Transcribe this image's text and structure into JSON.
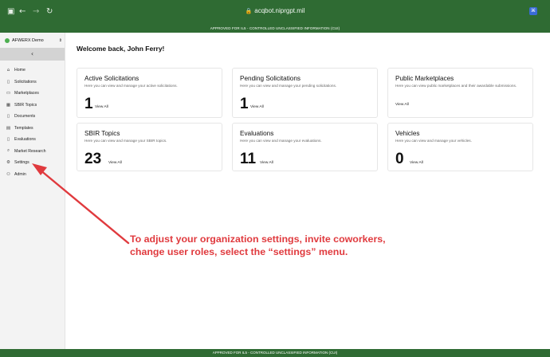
{
  "browser": {
    "url": "acqbot.niprgpt.mil"
  },
  "banner": {
    "top": "APPROVED FOR IL5 - CONTROLLED UNCLASSIFIED INFORMATION (CUI)",
    "bottom": "APPROVED FOR IL5 - CONTROLLED UNCLASSIFIED INFORMATION (CUI)"
  },
  "sidebar": {
    "org_name": "AFWERX Demo",
    "items": [
      {
        "label": "Home",
        "icon": "home-icon"
      },
      {
        "label": "Solicitations",
        "icon": "document-icon"
      },
      {
        "label": "Marketplaces",
        "icon": "store-icon"
      },
      {
        "label": "SBIR Topics",
        "icon": "grid-icon"
      },
      {
        "label": "Documents",
        "icon": "file-icon"
      },
      {
        "label": "Templates",
        "icon": "template-icon"
      },
      {
        "label": "Evaluations",
        "icon": "clipboard-icon"
      },
      {
        "label": "Market Research",
        "icon": "search-icon"
      },
      {
        "label": "Settings",
        "icon": "gear-icon"
      },
      {
        "label": "Admin",
        "icon": "user-gear-icon"
      }
    ]
  },
  "main": {
    "welcome": "Welcome back, John Ferry!",
    "cards": [
      {
        "title": "Active Solicitations",
        "desc": "Here you can view and manage your active solicitations.",
        "count": "1",
        "view_all": "View All"
      },
      {
        "title": "Pending Solicitations",
        "desc": "Here you can view and manage your pending solicitations.",
        "count": "1",
        "view_all": "View All"
      },
      {
        "title": "Public Marketplaces",
        "desc": "Here you can view public marketplaces and their awardable submissions.",
        "count": "",
        "view_all": "View All"
      },
      {
        "title": "SBIR Topics",
        "desc": "Here you can view and manage your SBIR topics.",
        "count": "23",
        "view_all": "View All"
      },
      {
        "title": "Evaluations",
        "desc": "Here you can view and manage your evaluations.",
        "count": "11",
        "view_all": "View All"
      },
      {
        "title": "Vehicles",
        "desc": "Here you can view and manage your vehicles.",
        "count": "0",
        "view_all": "View All"
      }
    ]
  },
  "annotation": {
    "lines": [
      "To adjust your organization settings, invite coworkers,",
      "change user roles, select the “settings” menu."
    ],
    "color": "#e03a3e"
  }
}
